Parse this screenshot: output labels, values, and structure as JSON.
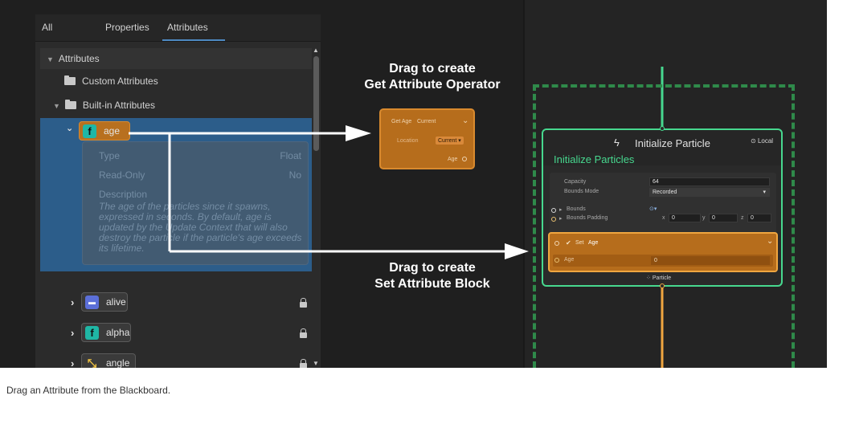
{
  "blackboard": {
    "tabs": [
      "All",
      "Properties",
      "Attributes"
    ],
    "active_tab": "Attributes",
    "section_title": "Attributes",
    "custom_folder": "Custom Attributes",
    "builtin_folder": "Built-in Attributes",
    "attributes": [
      {
        "name": "age",
        "icon": "float-f-icon",
        "selected": true
      },
      {
        "name": "alive",
        "icon": "bool-toggle-icon",
        "locked": true
      },
      {
        "name": "alpha",
        "icon": "float-f-icon",
        "locked": true
      },
      {
        "name": "angle",
        "icon": "vector-axes-icon",
        "locked": true
      }
    ],
    "age_details": {
      "type_label": "Type",
      "type_value": "Float",
      "readonly_label": "Read-Only",
      "readonly_value": "No",
      "description_label": "Description",
      "description_text": "The age of the particles since it spawns, expressed in seconds. By default, age is updated by the Update Context that will also destroy the particle if the particle's age exceeds its lifetime."
    }
  },
  "callouts": {
    "get_line1": "Drag to create",
    "get_line2": "Get Attribute Operator",
    "set_line1": "Drag to create",
    "set_line2": "Set Attribute Block"
  },
  "operator_node": {
    "title": "Get Age",
    "mode": "Current",
    "location_label": "Location",
    "location_value": "Current",
    "output_label": "Age"
  },
  "context_node": {
    "title": "Initialize Particle",
    "subtitle": "Initialize Particles",
    "space": "Local",
    "capacity_label": "Capacity",
    "capacity_value": "64",
    "bounds_mode_label": "Bounds Mode",
    "bounds_mode_value": "Recorded",
    "bounds_label": "Bounds",
    "bounds_padding_label": "Bounds Padding",
    "padding_x_label": "x",
    "padding_x": "0",
    "padding_y_label": "y",
    "padding_y": "0",
    "padding_z_label": "z",
    "padding_z": "0",
    "set_block_label": "Set",
    "set_block_attr": "Age",
    "set_input_label": "Age",
    "set_input_value": "0",
    "footer": "Particle"
  },
  "colors": {
    "accent_green": "#47d88f",
    "block_orange": "#b66d1c",
    "selection_blue": "#2c5d8a"
  },
  "caption": "Drag an Attribute from the Blackboard."
}
